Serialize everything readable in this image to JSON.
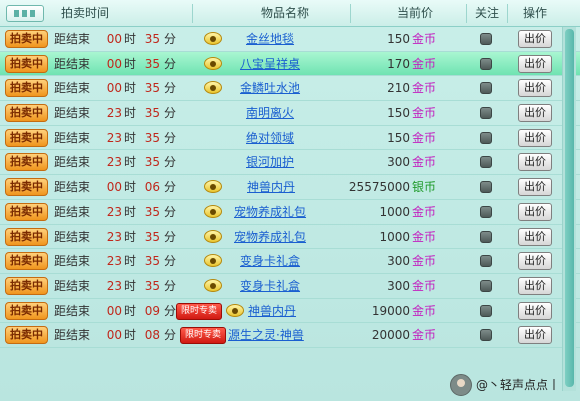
{
  "header": {
    "col_time": "拍卖时间",
    "col_name": "物品名称",
    "col_price": "当前价",
    "col_watch": "关注",
    "col_action": "操作"
  },
  "rows": [
    {
      "status": "拍卖中",
      "remain_label": "距结束",
      "hours": "00",
      "hour_unit": "时",
      "minutes": "35",
      "min_unit": "分",
      "name": "金丝地毯",
      "price": "150",
      "currency": "金币",
      "bid": "出价",
      "eye": true
    },
    {
      "status": "拍卖中",
      "remain_label": "距结束",
      "hours": "00",
      "hour_unit": "时",
      "minutes": "35",
      "min_unit": "分",
      "name": "八宝呈祥桌",
      "price": "170",
      "currency": "金币",
      "bid": "出价",
      "eye": true
    },
    {
      "status": "拍卖中",
      "remain_label": "距结束",
      "hours": "00",
      "hour_unit": "时",
      "minutes": "35",
      "min_unit": "分",
      "name": "金鳞吐水池",
      "price": "210",
      "currency": "金币",
      "bid": "出价",
      "eye": true
    },
    {
      "status": "拍卖中",
      "remain_label": "距结束",
      "hours": "23",
      "hour_unit": "时",
      "minutes": "35",
      "min_unit": "分",
      "name": "南明离火",
      "price": "150",
      "currency": "金币",
      "bid": "出价",
      "eye": false
    },
    {
      "status": "拍卖中",
      "remain_label": "距结束",
      "hours": "23",
      "hour_unit": "时",
      "minutes": "35",
      "min_unit": "分",
      "name": "绝对领域",
      "price": "150",
      "currency": "金币",
      "bid": "出价",
      "eye": false
    },
    {
      "status": "拍卖中",
      "remain_label": "距结束",
      "hours": "23",
      "hour_unit": "时",
      "minutes": "35",
      "min_unit": "分",
      "name": "银河加护",
      "price": "300",
      "currency": "金币",
      "bid": "出价",
      "eye": false
    },
    {
      "status": "拍卖中",
      "remain_label": "距结束",
      "hours": "00",
      "hour_unit": "时",
      "minutes": "06",
      "min_unit": "分",
      "name": "神兽内丹",
      "price": "25575000",
      "currency": "银币",
      "bid": "出价",
      "eye": true
    },
    {
      "status": "拍卖中",
      "remain_label": "距结束",
      "hours": "23",
      "hour_unit": "时",
      "minutes": "35",
      "min_unit": "分",
      "name": "宠物养成礼包",
      "price": "1000",
      "currency": "金币",
      "bid": "出价",
      "eye": true
    },
    {
      "status": "拍卖中",
      "remain_label": "距结束",
      "hours": "23",
      "hour_unit": "时",
      "minutes": "35",
      "min_unit": "分",
      "name": "宠物养成礼包",
      "price": "1000",
      "currency": "金币",
      "bid": "出价",
      "eye": true
    },
    {
      "status": "拍卖中",
      "remain_label": "距结束",
      "hours": "23",
      "hour_unit": "时",
      "minutes": "35",
      "min_unit": "分",
      "name": "变身卡礼盒",
      "price": "300",
      "currency": "金币",
      "bid": "出价",
      "eye": true
    },
    {
      "status": "拍卖中",
      "remain_label": "距结束",
      "hours": "23",
      "hour_unit": "时",
      "minutes": "35",
      "min_unit": "分",
      "name": "变身卡礼盒",
      "price": "300",
      "currency": "金币",
      "bid": "出价",
      "eye": true
    },
    {
      "status": "拍卖中",
      "remain_label": "距结束",
      "hours": "00",
      "hour_unit": "时",
      "minutes": "09",
      "min_unit": "分",
      "name": "神兽内丹",
      "price": "19000",
      "currency": "金币",
      "bid": "出价",
      "eye": true,
      "tag": "限时专卖"
    },
    {
      "status": "拍卖中",
      "remain_label": "距结束",
      "hours": "00",
      "hour_unit": "时",
      "minutes": "08",
      "min_unit": "分",
      "name": "源生之灵·神兽",
      "price": "20000",
      "currency": "金币",
      "bid": "出价",
      "eye": false,
      "tag": "限时专卖"
    }
  ],
  "footer": {
    "username": "@丶轻声点点丨"
  },
  "colors": {
    "gold": "#c21fbf",
    "silver": "#1f9a2a",
    "highlight_row": "#6fe3b2"
  }
}
